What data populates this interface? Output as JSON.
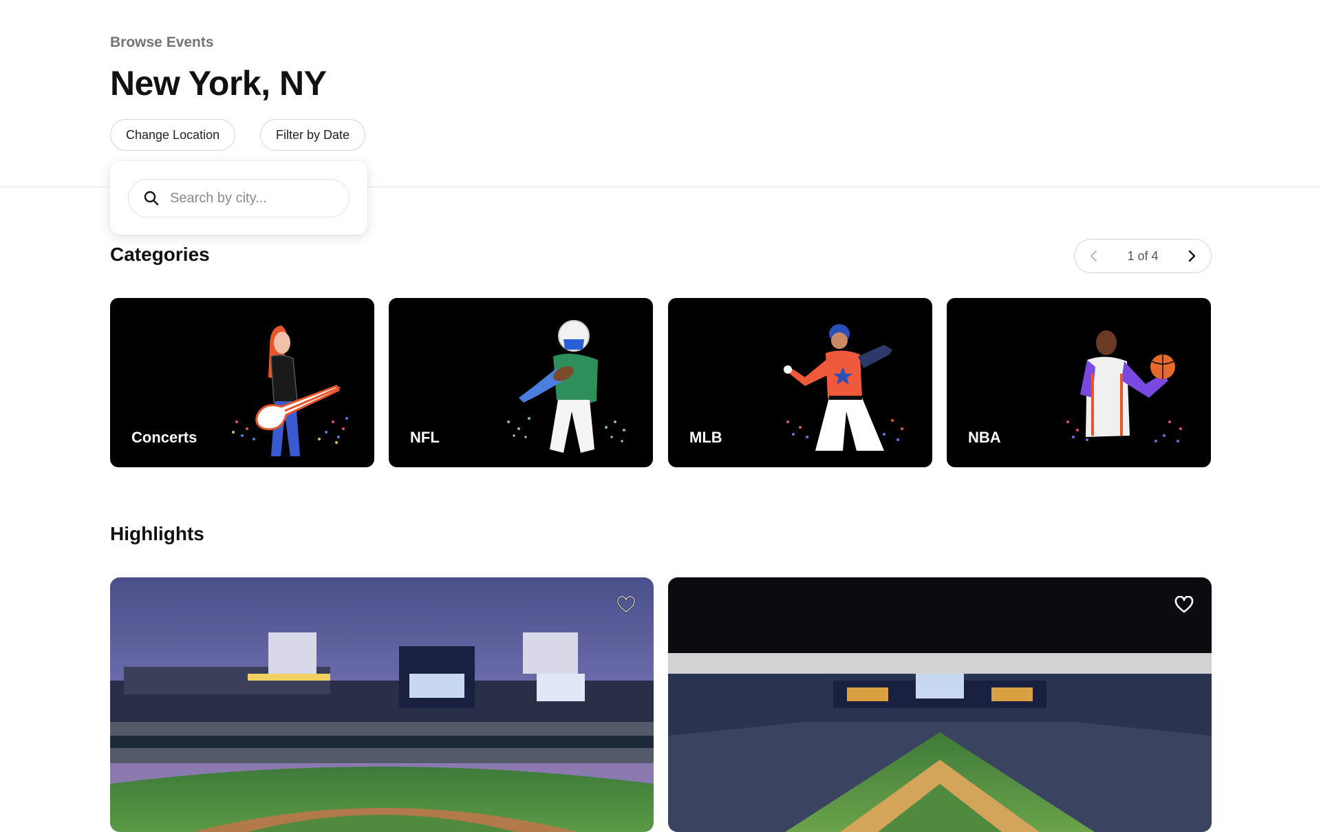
{
  "header": {
    "eyebrow": "Browse Events",
    "title": "New York, NY",
    "buttons": {
      "change_location": "Change Location",
      "filter_by_date": "Filter by Date"
    }
  },
  "location_dropdown": {
    "search_placeholder": "Search by city...",
    "search_value": ""
  },
  "categories": {
    "title": "Categories",
    "pager": {
      "text": "1 of 4",
      "current": 1,
      "total": 4
    },
    "items": [
      {
        "label": "Concerts",
        "icon": "rock-guitarist-illustration"
      },
      {
        "label": "NFL",
        "icon": "football-player-illustration"
      },
      {
        "label": "MLB",
        "icon": "baseball-pitcher-illustration"
      },
      {
        "label": "NBA",
        "icon": "basketball-player-illustration"
      }
    ]
  },
  "highlights": {
    "title": "Highlights",
    "items": [
      {
        "image": "baseball-stadium-dusk-photo",
        "favorite_icon": "heart-outline-icon"
      },
      {
        "image": "baseball-stadium-night-aerial-photo",
        "favorite_icon": "heart-outline-icon"
      }
    ]
  },
  "colors": {
    "text_primary": "#111111",
    "text_muted": "#737373",
    "border": "#d6d6d6",
    "card_bg": "#000000"
  }
}
